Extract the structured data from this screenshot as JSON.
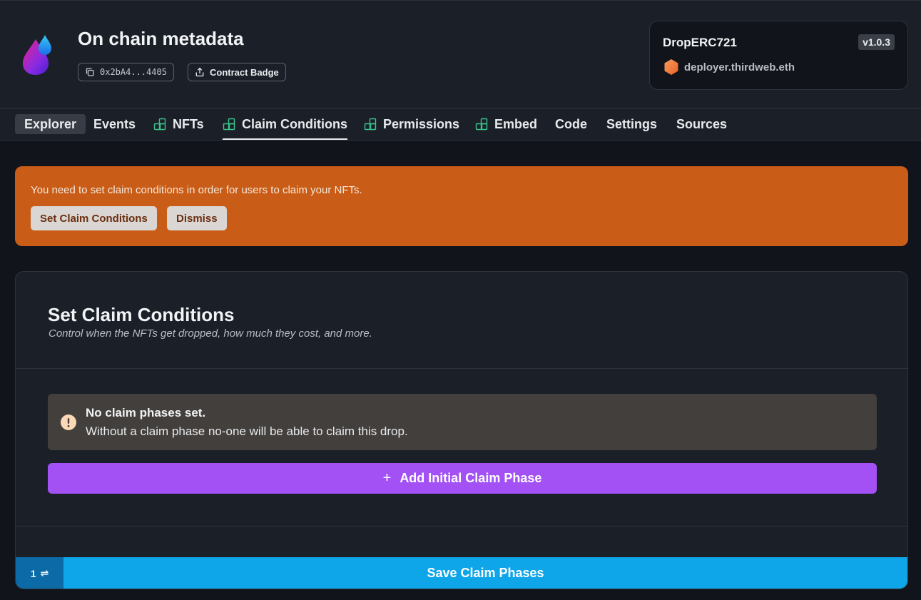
{
  "header": {
    "title": "On chain metadata",
    "address": "0x2bA4...4405",
    "badge_label": "Contract Badge"
  },
  "contract": {
    "name": "DropERC721",
    "version": "v1.0.3",
    "deployer": "deployer.thirdweb.eth"
  },
  "tabs": [
    {
      "label": "Explorer",
      "icon": "none",
      "state": "selected"
    },
    {
      "label": "Events",
      "icon": "none"
    },
    {
      "label": "NFTs",
      "icon": "extension-icon"
    },
    {
      "label": "Claim Conditions",
      "icon": "extension-icon",
      "state": "active"
    },
    {
      "label": "Permissions",
      "icon": "extension-icon"
    },
    {
      "label": "Embed",
      "icon": "extension-icon"
    },
    {
      "label": "Code",
      "icon": "none"
    },
    {
      "label": "Settings",
      "icon": "none"
    },
    {
      "label": "Sources",
      "icon": "none"
    }
  ],
  "banner": {
    "message": "You need to set claim conditions in order for users to claim your NFTs.",
    "set_label": "Set Claim Conditions",
    "dismiss_label": "Dismiss"
  },
  "card": {
    "title": "Set Claim Conditions",
    "subtitle": "Control when the NFTs get dropped, how much they cost, and more.",
    "notice_title": "No claim phases set.",
    "notice_body": "Without a claim phase no-one will be able to claim this drop.",
    "add_label": "Add Initial Claim Phase",
    "phase_count": "1",
    "save_label": "Save Claim Phases"
  },
  "colors": {
    "banner": "#c95d17",
    "add_button": "#a351f5",
    "save_button": "#0ea5e9",
    "extension_icon": "#3bc48d"
  }
}
